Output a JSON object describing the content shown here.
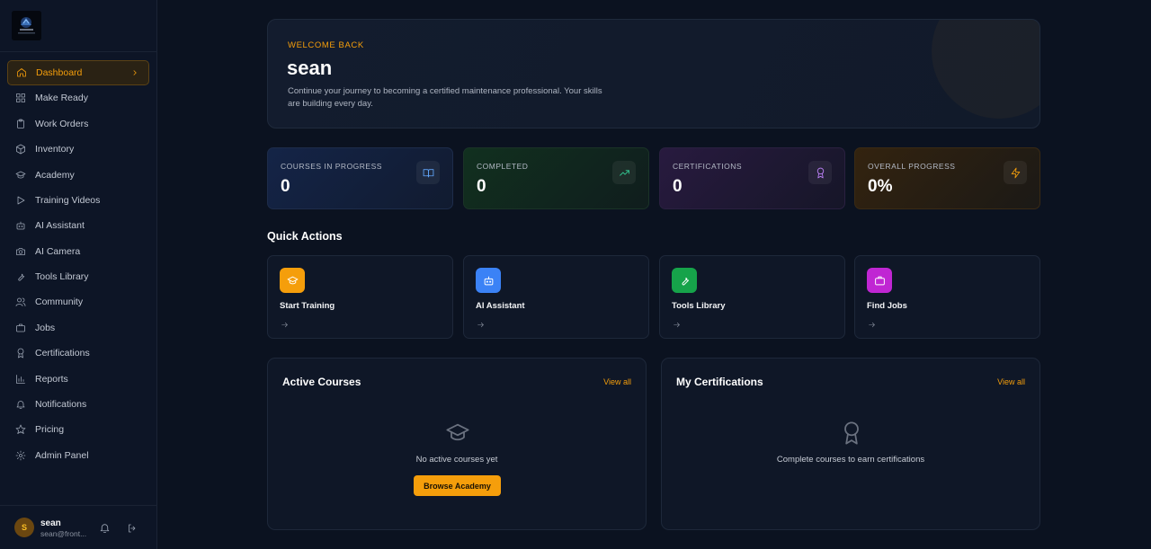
{
  "sidebar": {
    "items": [
      {
        "label": "Dashboard",
        "icon": "home-icon"
      },
      {
        "label": "Make Ready",
        "icon": "grid-icon"
      },
      {
        "label": "Work Orders",
        "icon": "clipboard-icon"
      },
      {
        "label": "Inventory",
        "icon": "box-icon"
      },
      {
        "label": "Academy",
        "icon": "graduation-cap-icon"
      },
      {
        "label": "Training Videos",
        "icon": "play-icon"
      },
      {
        "label": "AI Assistant",
        "icon": "bot-icon"
      },
      {
        "label": "AI Camera",
        "icon": "camera-icon"
      },
      {
        "label": "Tools Library",
        "icon": "wrench-icon"
      },
      {
        "label": "Community",
        "icon": "users-icon"
      },
      {
        "label": "Jobs",
        "icon": "briefcase-icon"
      },
      {
        "label": "Certifications",
        "icon": "award-icon"
      },
      {
        "label": "Reports",
        "icon": "bar-chart-icon"
      },
      {
        "label": "Notifications",
        "icon": "bell-icon"
      },
      {
        "label": "Pricing",
        "icon": "star-icon"
      },
      {
        "label": "Admin Panel",
        "icon": "settings-icon"
      }
    ],
    "active_index": 0
  },
  "user": {
    "initial": "S",
    "name": "sean",
    "email": "sean@front..."
  },
  "welcome": {
    "kicker": "WELCOME BACK",
    "name": "sean",
    "subtitle": "Continue your journey to becoming a certified maintenance professional. Your skills are building every day."
  },
  "stats": [
    {
      "label": "COURSES IN PROGRESS",
      "value": "0",
      "icon": "book-open-icon",
      "color": "#60a5fa"
    },
    {
      "label": "COMPLETED",
      "value": "0",
      "icon": "trending-up-icon",
      "color": "#34d399"
    },
    {
      "label": "CERTIFICATIONS",
      "value": "0",
      "icon": "award-icon",
      "color": "#c084fc"
    },
    {
      "label": "OVERALL PROGRESS",
      "value": "0%",
      "icon": "zap-icon",
      "color": "#f59e0b"
    }
  ],
  "quick_actions": {
    "title": "Quick Actions",
    "items": [
      {
        "label": "Start Training",
        "icon": "graduation-cap-icon",
        "color": "#f59e0b"
      },
      {
        "label": "AI Assistant",
        "icon": "bot-icon",
        "color": "#3b82f6"
      },
      {
        "label": "Tools Library",
        "icon": "wrench-icon",
        "color": "#16a34a"
      },
      {
        "label": "Find Jobs",
        "icon": "briefcase-icon",
        "color": "#c026d3"
      }
    ]
  },
  "active_courses": {
    "title": "Active Courses",
    "view_all": "View all",
    "empty_text": "No active courses yet",
    "button": "Browse Academy"
  },
  "my_certifications": {
    "title": "My Certifications",
    "view_all": "View all",
    "empty_text": "Complete courses to earn certifications"
  }
}
